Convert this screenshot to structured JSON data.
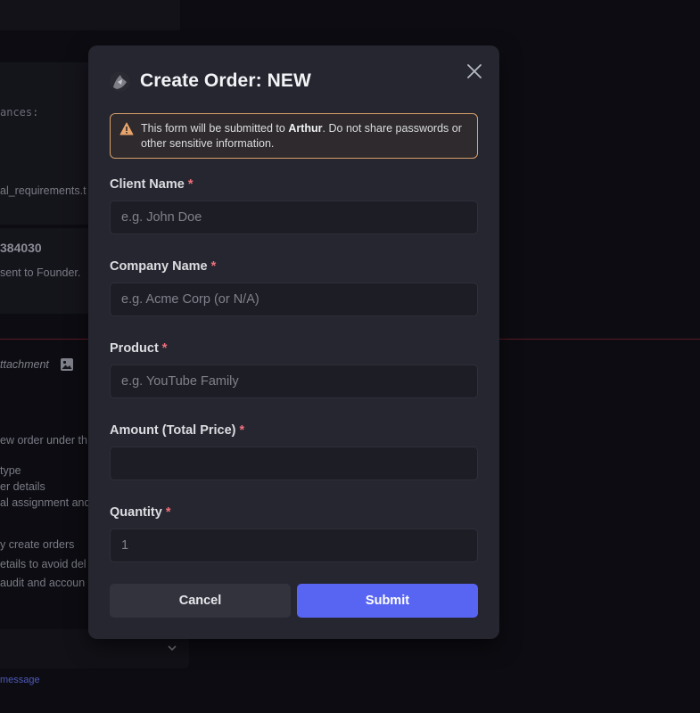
{
  "background": {
    "mono_text": "ances:",
    "file_text": "al_requirements.t",
    "order_number": "384030",
    "sent_text": "sent to Founder.",
    "attachment_label": "ttachment",
    "lines": [
      "ew order under th",
      "type",
      "er details",
      "al assignment and",
      "y create orders",
      "etails to avoid del",
      " audit and accoun"
    ],
    "message_link": "message"
  },
  "modal": {
    "title": "Create Order: NEW",
    "warning": {
      "prefix": "This form will be submitted to ",
      "recipient": "Arthur",
      "suffix": ". Do not share passwords or other sensitive information."
    },
    "fields": {
      "client_name": {
        "label": "Client Name",
        "required_mark": "*",
        "placeholder": "e.g. John Doe",
        "value": ""
      },
      "company_name": {
        "label": "Company Name",
        "required_mark": "*",
        "placeholder": "e.g. Acme Corp (or N/A)",
        "value": ""
      },
      "product": {
        "label": "Product",
        "required_mark": "*",
        "placeholder": "e.g. YouTube Family",
        "value": ""
      },
      "amount": {
        "label": "Amount (Total Price)",
        "required_mark": "*",
        "placeholder": "",
        "value": ""
      },
      "quantity": {
        "label": "Quantity",
        "required_mark": "*",
        "placeholder": "1",
        "value": ""
      }
    },
    "buttons": {
      "cancel": "Cancel",
      "submit": "Submit"
    }
  },
  "colors": {
    "accent": "#5865f2",
    "warning_border": "#d8a16a",
    "required": "#f2707a"
  },
  "icons": {
    "close": "close-icon",
    "warning": "warning-icon",
    "avatar": "avatar"
  }
}
